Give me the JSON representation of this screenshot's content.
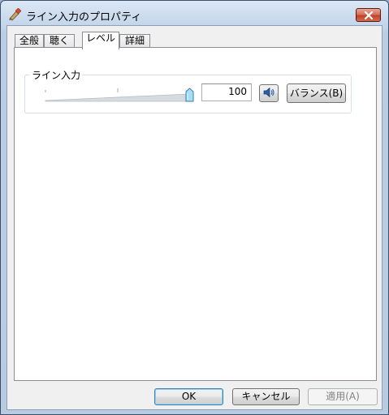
{
  "window": {
    "title": "ライン入力のプロパティ"
  },
  "tabs": [
    {
      "label": "全般",
      "active": false
    },
    {
      "label": "聴く",
      "active": false
    },
    {
      "label": "レベル",
      "active": true
    },
    {
      "label": "詳細",
      "active": false
    }
  ],
  "level": {
    "group_label": "ライン入力",
    "value": "100",
    "slider_percent": 100,
    "balance_label": "バランス(B)"
  },
  "buttons": {
    "ok": "OK",
    "cancel": "キャンセル",
    "apply": "適用(A)"
  },
  "colors": {
    "close_button": "#c0432b",
    "slider_thumb": "#7fd0f0"
  },
  "icons": {
    "title": "speaker-properties-icon",
    "close": "close-icon",
    "mute": "speaker-icon"
  }
}
